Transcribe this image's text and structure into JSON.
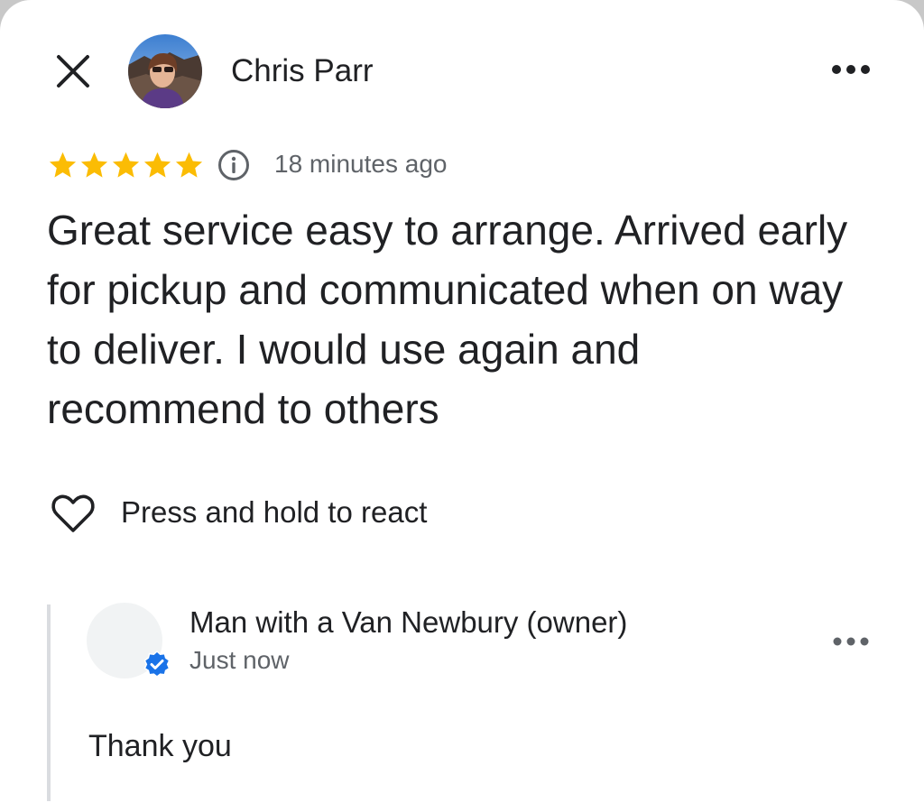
{
  "header": {
    "reviewer_name": "Chris Parr",
    "close_icon": "close-icon",
    "more_icon": "more-horizontal-icon"
  },
  "review": {
    "rating": 5,
    "rating_max": 5,
    "star_color": "#fbbc04",
    "timestamp": "18 minutes ago",
    "text": "Great service easy to arrange. Arrived early for pickup and communicated when on way to deliver. I would use again and recommend to others"
  },
  "reaction": {
    "label": "Press and hold to react",
    "icon": "heart-outline-icon"
  },
  "owner_reply": {
    "name": "Man with a Van Newbury (owner)",
    "time": "Just now",
    "text": "Thank you",
    "verified_color": "#1a73e8"
  },
  "colors": {
    "text_primary": "#202124",
    "text_secondary": "#5f6368",
    "divider": "#dadce0"
  }
}
